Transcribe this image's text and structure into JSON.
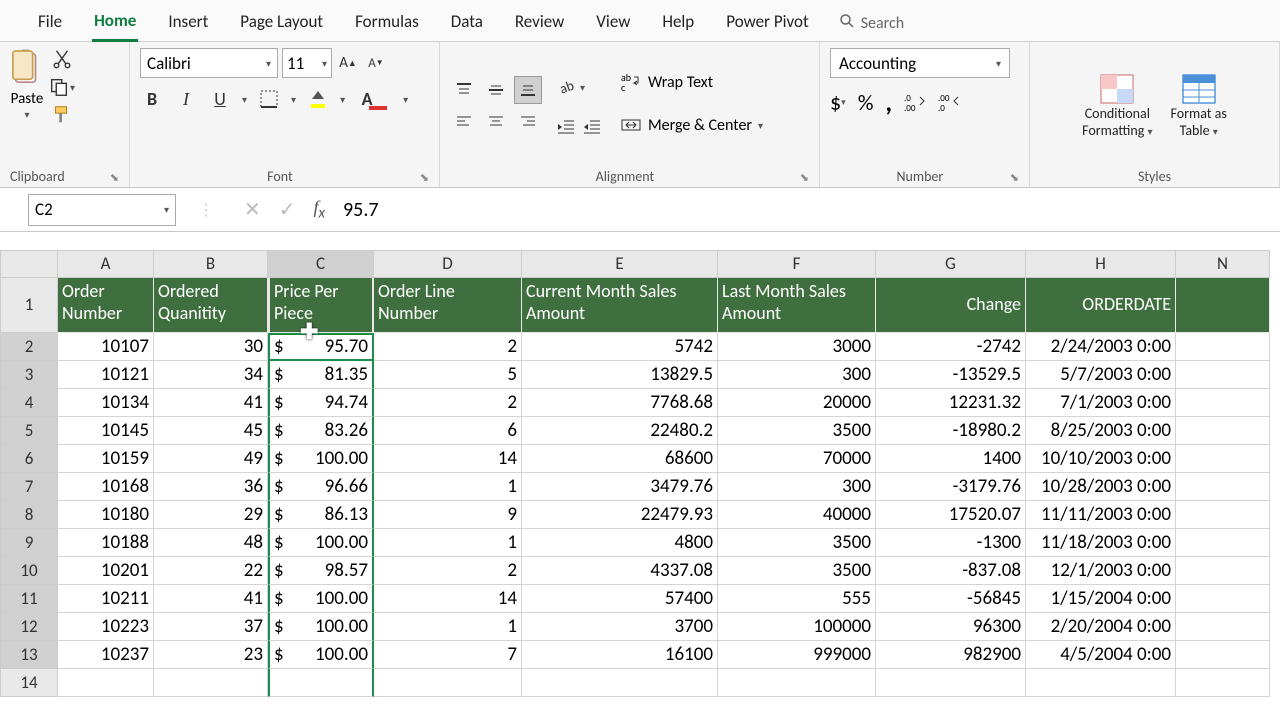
{
  "menu": {
    "tabs": [
      "File",
      "Home",
      "Insert",
      "Page Layout",
      "Formulas",
      "Data",
      "Review",
      "View",
      "Help",
      "Power Pivot"
    ],
    "active": 1,
    "search": "Search"
  },
  "ribbon": {
    "clipboard": {
      "paste": "Paste",
      "label": "Clipboard"
    },
    "font": {
      "name": "Calibri",
      "size": "11",
      "label": "Font"
    },
    "alignment": {
      "wrap": "Wrap Text",
      "merge": "Merge & Center",
      "label": "Alignment"
    },
    "number": {
      "format": "Accounting",
      "label": "Number"
    },
    "styles": {
      "cond": "Conditional",
      "cond2": "Formatting",
      "table": "Format as",
      "table2": "Table",
      "label": "Styles"
    }
  },
  "nameBox": "C2",
  "formula": "95.7",
  "columns": [
    "A",
    "B",
    "C",
    "D",
    "E",
    "F",
    "G",
    "H",
    "N"
  ],
  "headers": {
    "A": "Order Number",
    "B": "Ordered Quanitity",
    "C": "Price Per Piece",
    "D": "Order Line Number",
    "E": "Current Month Sales Amount",
    "F": "Last Month Sales Amount",
    "G": "Change",
    "H": "ORDERDATE"
  },
  "rows": [
    {
      "n": 2,
      "A": "10107",
      "B": "30",
      "Cs": "$",
      "Cv": "95.70",
      "D": "2",
      "E": "5742",
      "F": "3000",
      "G": "-2742",
      "H": "2/24/2003 0:00"
    },
    {
      "n": 3,
      "A": "10121",
      "B": "34",
      "Cs": "$",
      "Cv": "81.35",
      "D": "5",
      "E": "13829.5",
      "F": "300",
      "G": "-13529.5",
      "H": "5/7/2003 0:00"
    },
    {
      "n": 4,
      "A": "10134",
      "B": "41",
      "Cs": "$",
      "Cv": "94.74",
      "D": "2",
      "E": "7768.68",
      "F": "20000",
      "G": "12231.32",
      "H": "7/1/2003 0:00"
    },
    {
      "n": 5,
      "A": "10145",
      "B": "45",
      "Cs": "$",
      "Cv": "83.26",
      "D": "6",
      "E": "22480.2",
      "F": "3500",
      "G": "-18980.2",
      "H": "8/25/2003 0:00"
    },
    {
      "n": 6,
      "A": "10159",
      "B": "49",
      "Cs": "$",
      "Cv": "100.00",
      "D": "14",
      "E": "68600",
      "F": "70000",
      "G": "1400",
      "H": "10/10/2003 0:00"
    },
    {
      "n": 7,
      "A": "10168",
      "B": "36",
      "Cs": "$",
      "Cv": "96.66",
      "D": "1",
      "E": "3479.76",
      "F": "300",
      "G": "-3179.76",
      "H": "10/28/2003 0:00"
    },
    {
      "n": 8,
      "A": "10180",
      "B": "29",
      "Cs": "$",
      "Cv": "86.13",
      "D": "9",
      "E": "22479.93",
      "F": "40000",
      "G": "17520.07",
      "H": "11/11/2003 0:00"
    },
    {
      "n": 9,
      "A": "10188",
      "B": "48",
      "Cs": "$",
      "Cv": "100.00",
      "D": "1",
      "E": "4800",
      "F": "3500",
      "G": "-1300",
      "H": "11/18/2003 0:00"
    },
    {
      "n": 10,
      "A": "10201",
      "B": "22",
      "Cs": "$",
      "Cv": "98.57",
      "D": "2",
      "E": "4337.08",
      "F": "3500",
      "G": "-837.08",
      "H": "12/1/2003 0:00"
    },
    {
      "n": 11,
      "A": "10211",
      "B": "41",
      "Cs": "$",
      "Cv": "100.00",
      "D": "14",
      "E": "57400",
      "F": "555",
      "G": "-56845",
      "H": "1/15/2004 0:00"
    },
    {
      "n": 12,
      "A": "10223",
      "B": "37",
      "Cs": "$",
      "Cv": "100.00",
      "D": "1",
      "E": "3700",
      "F": "100000",
      "G": "96300",
      "H": "2/20/2004 0:00"
    },
    {
      "n": 13,
      "A": "10237",
      "B": "23",
      "Cs": "$",
      "Cv": "100.00",
      "D": "7",
      "E": "16100",
      "F": "999000",
      "G": "982900",
      "H": "4/5/2004 0:00"
    }
  ],
  "blankRow": "14",
  "activeCell": "C2",
  "selectedColumn": "C"
}
